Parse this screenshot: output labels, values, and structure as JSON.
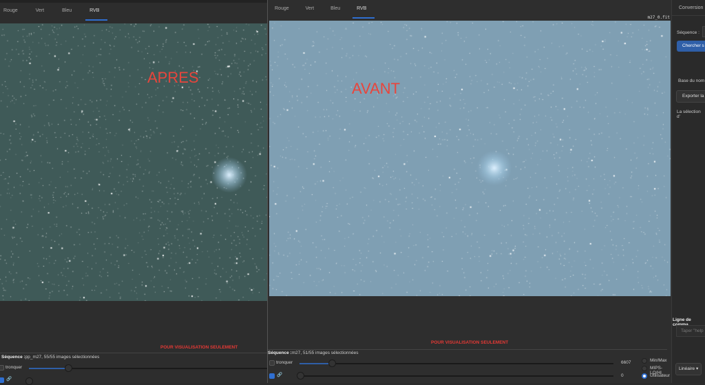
{
  "left_window": {
    "tabs": [
      "Rouge",
      "Vert",
      "Bleu",
      "RVB"
    ],
    "active_tab": "RVB",
    "overlay_label": "APRES",
    "warning": "POUR VISUALISATION SEULEMENT",
    "status_label": "Séquence :",
    "status_text": "pp_m27, 55/55 images sélectionnées",
    "tronquer_label": "tronquer"
  },
  "right_window": {
    "tabs": [
      "Rouge",
      "Vert",
      "Bleu",
      "RVB"
    ],
    "active_tab": "RVB",
    "filename": "m27_0.fit",
    "overlay_label": "AVANT",
    "warning": "POUR VISUALISATION SEULEMENT",
    "status_label": "Séquence :",
    "status_text": "m27, 51/55 images sélectionnées",
    "tronquer_label": "tronquer",
    "high_value": "6607",
    "low_value": "0",
    "radio_options": [
      "Min/Max",
      "MIPS-LO/HI",
      "Utilisateur"
    ],
    "selected_radio": "Utilisateur",
    "scale_dropdown": "Linéaire"
  },
  "side_panel": {
    "tab": "Conversion",
    "sequence_label": "Séquence :",
    "search_button": "Chercher s",
    "base_name_label": "Base du nom",
    "export_button": "Exporter la",
    "selection_text": "La sélection d'",
    "command_line_label": "Ligne de comma",
    "command_placeholder": "Taper \"help"
  },
  "colors": {
    "accent": "#2f6fd1",
    "warning": "#e53935",
    "overlay": "#e8453c",
    "after_sky": "#3f5a58",
    "before_sky": "#7f9fb3"
  }
}
